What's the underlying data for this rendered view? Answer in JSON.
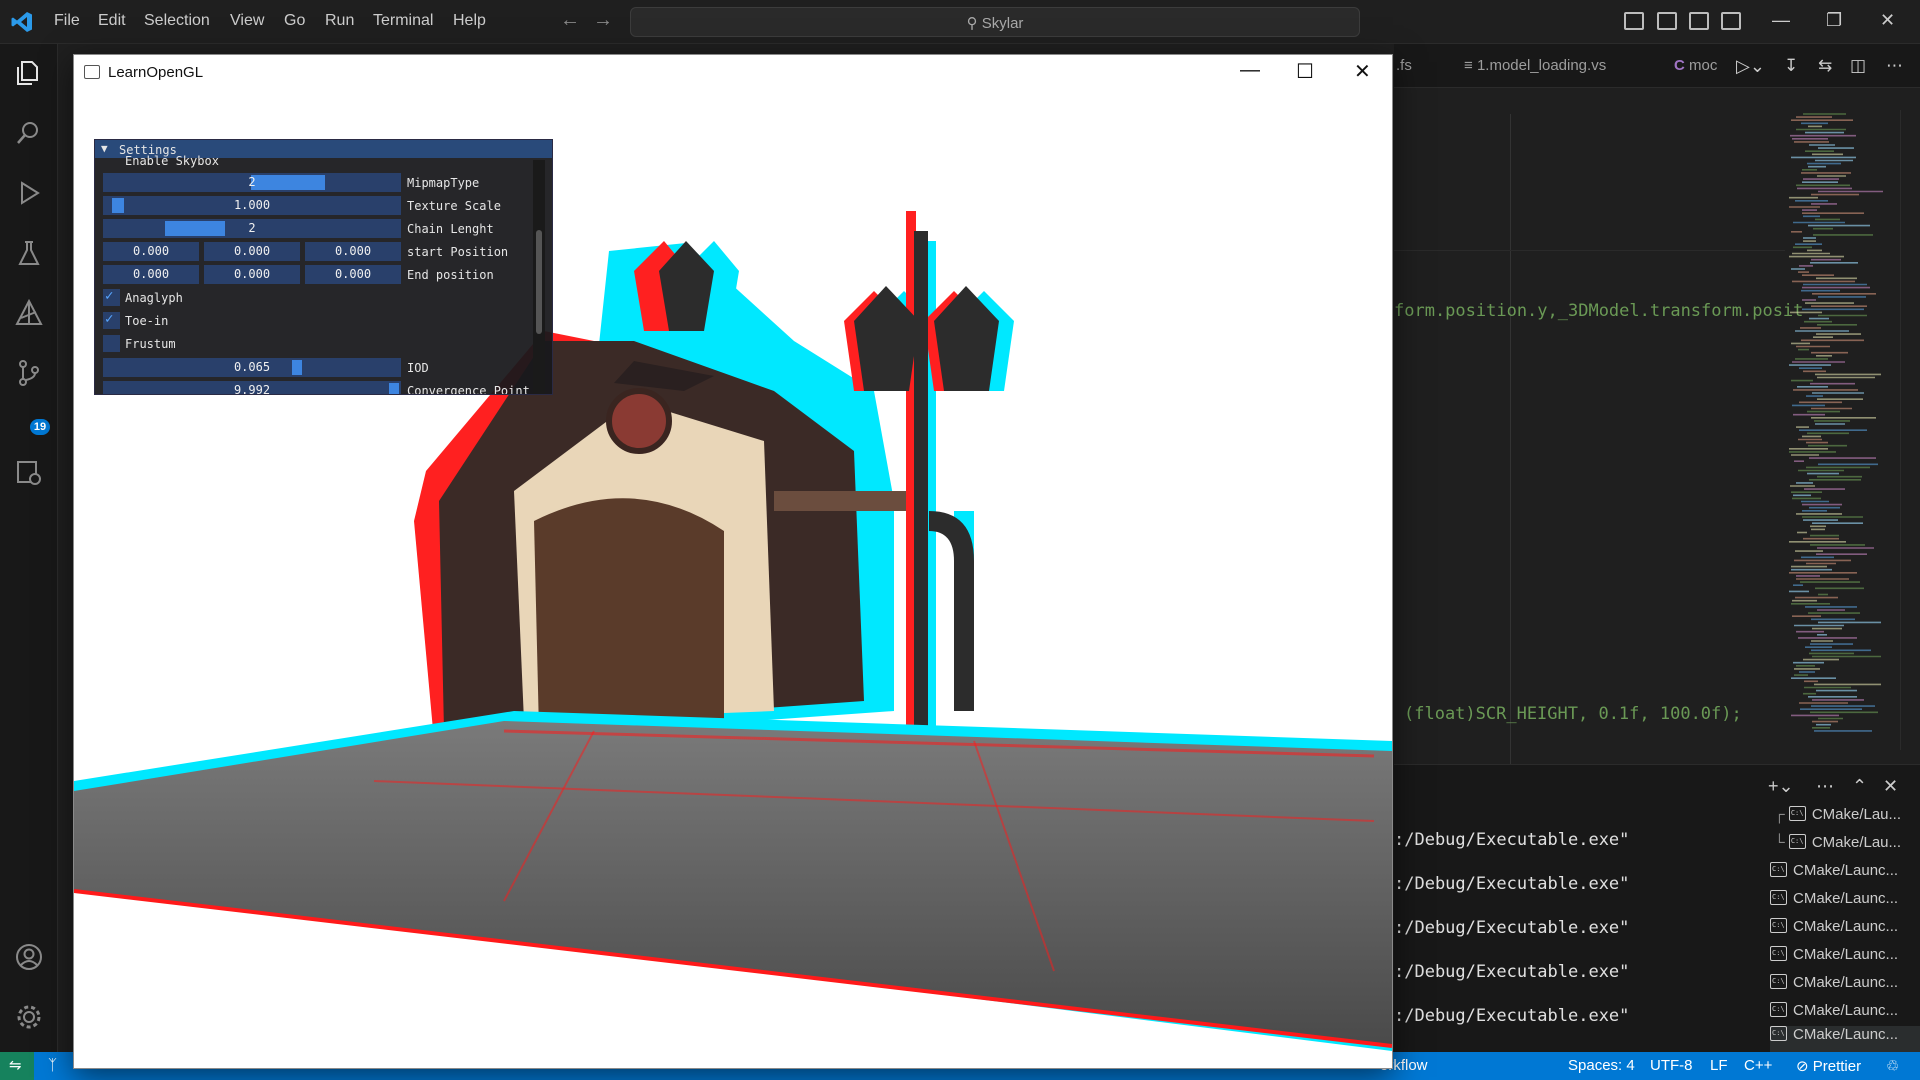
{
  "menu": [
    "File",
    "Edit",
    "Selection",
    "View",
    "Go",
    "Run",
    "Terminal",
    "Help"
  ],
  "command_center": "Skylar",
  "tabs": [
    ".fs",
    "1.model_loading.vs",
    "moc"
  ],
  "code_lines": [
    "form.position.y,_3DModel.transform.posit",
    "(float)SCR_HEIGHT, 0.1f, 100.0f);"
  ],
  "terminal": {
    "lines": [
      ":/Debug/Executable.exe\"",
      ":/Debug/Executable.exe\"",
      ":/Debug/Executable.exe\"",
      ":/Debug/Executable.exe\"",
      ":/Debug/Executable.exe\""
    ],
    "sessions": [
      "CMake/Lau...",
      "CMake/Lau...",
      "CMake/Launc...",
      "CMake/Launc...",
      "CMake/Launc...",
      "CMake/Launc...",
      "CMake/Launc...",
      "CMake/Launc...",
      "CMake/Launc..."
    ]
  },
  "activity": {
    "scm_badge": "19"
  },
  "status": {
    "workflow": "orkflow",
    "spaces": "Spaces: 4",
    "encoding": "UTF-8",
    "eol": "LF",
    "language": "C++",
    "prettier": "Prettier"
  },
  "gl_window": {
    "title": "LearnOpenGL",
    "settings": {
      "header": "Settings",
      "enable_skybox": "Enable Skybox",
      "mipmap_value": "2",
      "mipmap_fraction": 0.5,
      "mipmap_label": "MipmapType",
      "texture_scale_value": "1.000",
      "texture_scale_fraction": 0.0,
      "texture_scale_label": "Texture Scale",
      "chain_value": "2",
      "chain_label": "Chain Lenght",
      "start_values": [
        "0.000",
        "0.000",
        "0.000"
      ],
      "start_label": "start Position",
      "end_values": [
        "0.000",
        "0.000",
        "0.000"
      ],
      "end_label": "End position",
      "anaglyph": "Anaglyph",
      "anaglyph_checked": true,
      "toein": "Toe-in",
      "toein_checked": true,
      "frustum": "Frustum",
      "frustum_checked": false,
      "iod_value": "0.065",
      "iod_label": "IOD",
      "convergence_value": "9.992",
      "convergence_label": "Convergence Point"
    }
  },
  "colors": {
    "accent": "#0078d4",
    "remote": "#16825d",
    "anaglyph_red": "#ff1a1a",
    "anaglyph_cyan": "#00f0ff"
  }
}
